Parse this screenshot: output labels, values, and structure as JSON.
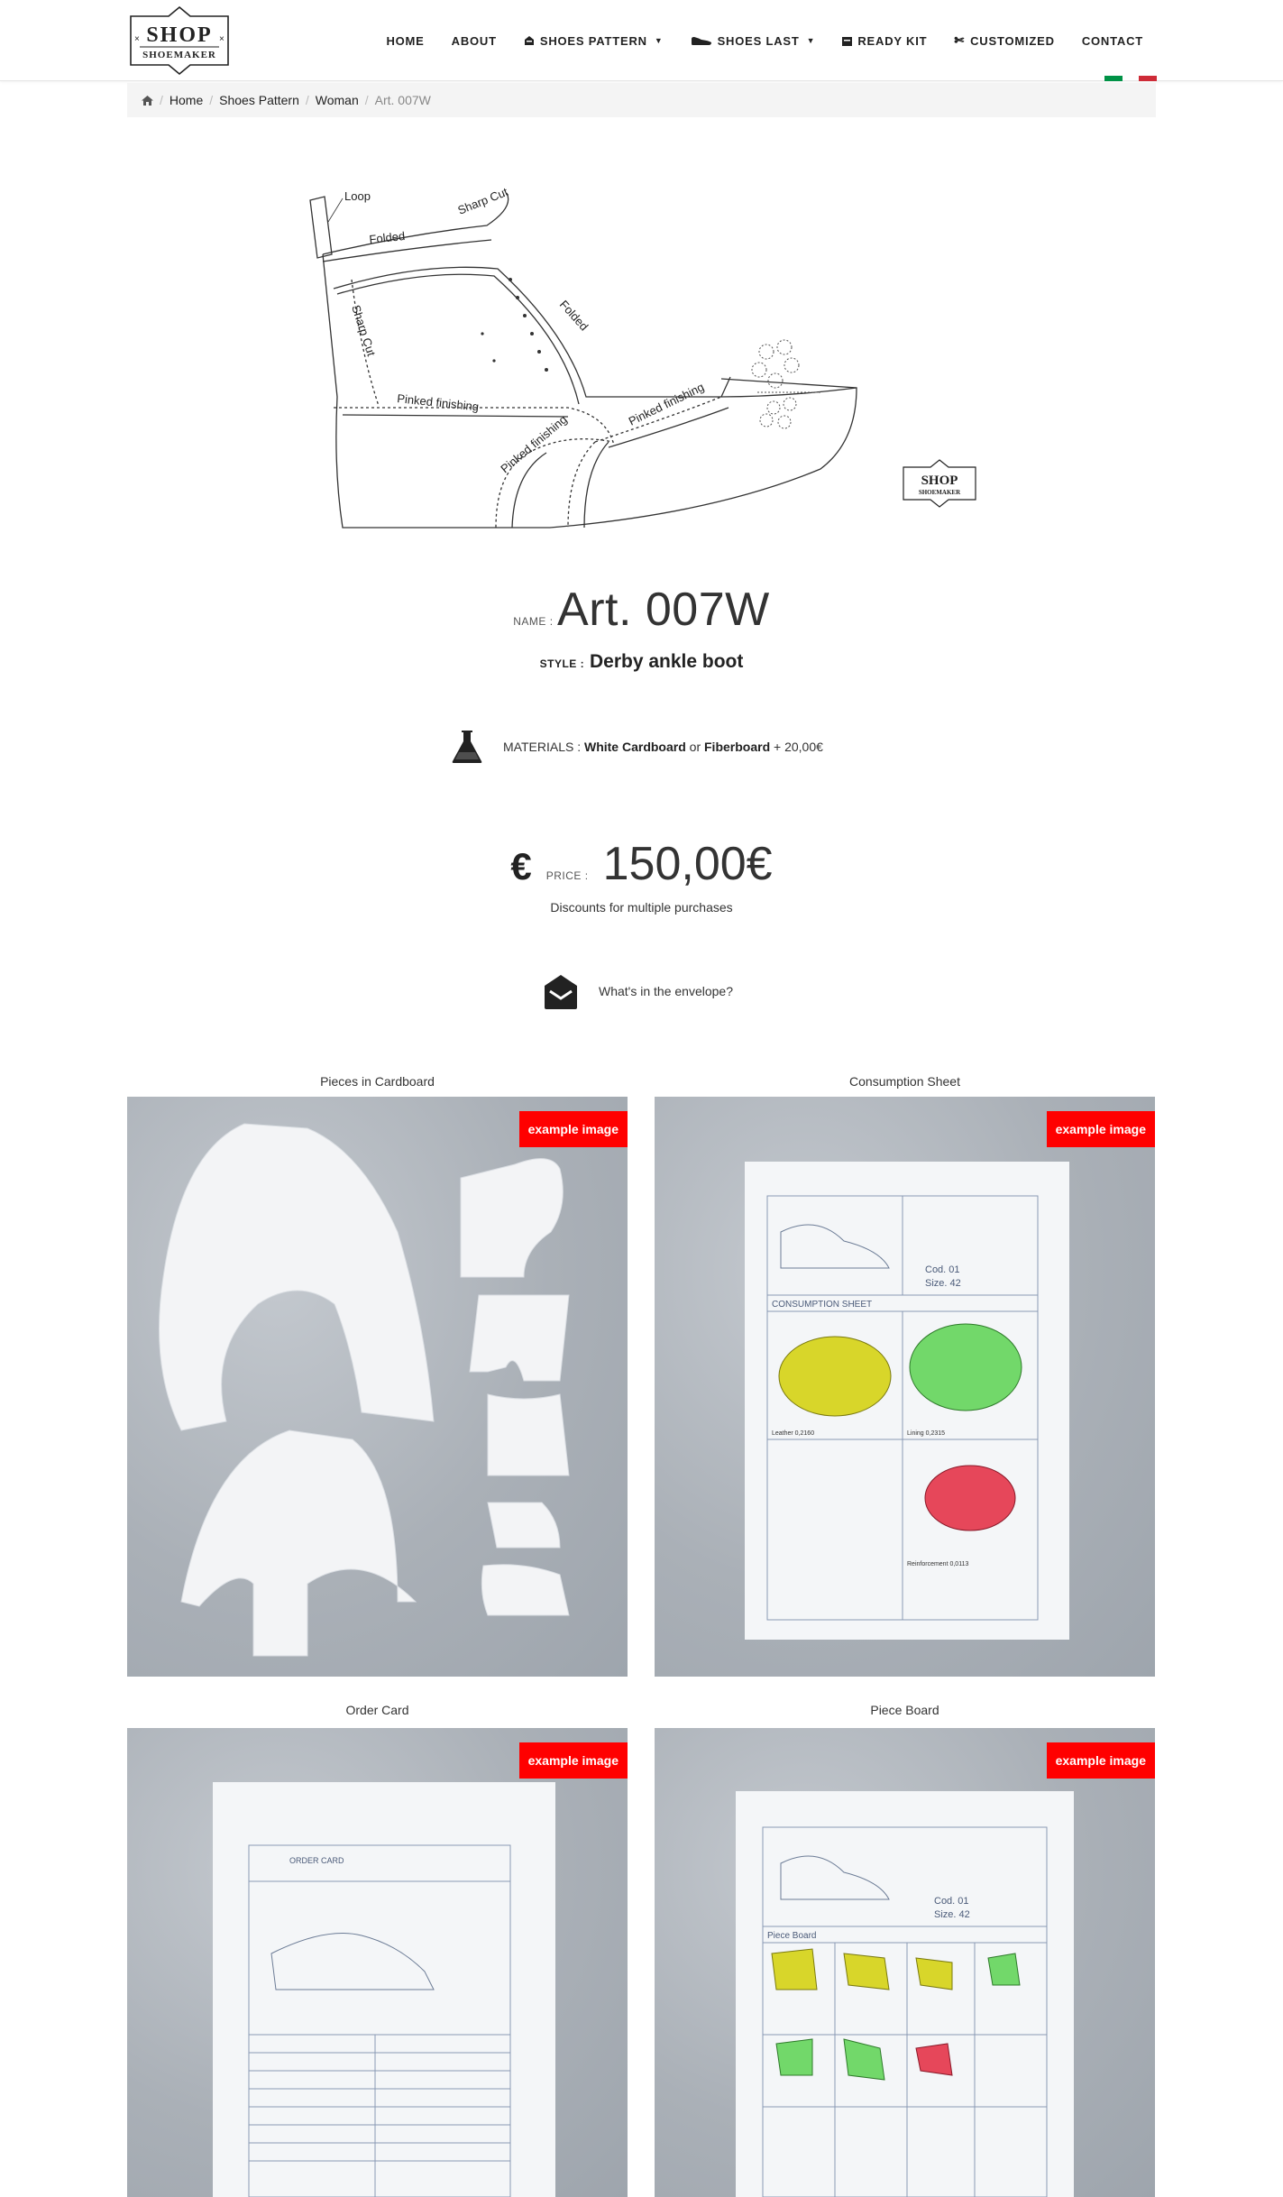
{
  "brand": {
    "logo_line1": "SHOP",
    "logo_line2": "SHOEMAKER"
  },
  "nav": [
    {
      "label": "HOME",
      "icon": ""
    },
    {
      "label": "ABOUT",
      "icon": ""
    },
    {
      "label": "SHOES PATTERN",
      "icon": "pattern-icon",
      "caret": true
    },
    {
      "label": "SHOES LAST",
      "icon": "shoe-last-icon",
      "caret": true
    },
    {
      "label": "READY KIT",
      "icon": "kit-icon"
    },
    {
      "label": "CUSTOMIZED",
      "icon": "scissors-icon"
    },
    {
      "label": "CONTACT",
      "icon": ""
    }
  ],
  "languages": [
    {
      "name": "Italian",
      "colors": [
        "#009246",
        "#ffffff",
        "#ce2b37"
      ]
    },
    {
      "name": "English",
      "colors": [
        "#ce2b37",
        "#ffffff",
        "#ce2b37"
      ]
    }
  ],
  "breadcrumb": {
    "home_icon": "home-icon",
    "items": [
      "Home",
      "Shoes Pattern",
      "Woman"
    ],
    "current": "Art. 007W"
  },
  "drawing_labels": {
    "loop": "Loop",
    "folded1": "Folded",
    "sharp_cut1": "Sharp Cut",
    "folded2": "Folded",
    "sharp_cut2": "Sharp Cut",
    "pinked1": "Pinked finishing",
    "pinked2": "Pinked finishing",
    "pinked3": "Pinked finishing"
  },
  "product": {
    "name_label": "NAME :",
    "name": "Art. 007W",
    "style_label": "STYLE :",
    "style": "Derby ankle boot",
    "materials_label": "MATERIALS :",
    "material1": "White Cardboard",
    "or_word": "or",
    "material2": "Fiberboard",
    "material2_extra": "+ 20,00€",
    "currency_symbol": "€",
    "price_label": "PRICE :",
    "price": "150,00€",
    "discount_note": "Discounts for multiple purchases",
    "envelope_link": "What's in the envelope?"
  },
  "gallery": {
    "badge": "example image",
    "items": [
      {
        "caption": "Pieces in Cardboard"
      },
      {
        "caption": "Consumption Sheet"
      },
      {
        "caption": "Order Card"
      },
      {
        "caption": "Piece Board"
      }
    ]
  },
  "sheet_texts": {
    "cod_label": "Cod.",
    "cod_value": "01",
    "size_label": "Size.",
    "size_value": "42",
    "consumption_title": "CONSUMPTION SHEET",
    "leather": "Leather",
    "leather_val": "0,2160",
    "lining": "Lining",
    "lining_val": "0,2315",
    "reinforcement": "Reinforcement",
    "reinforcement_val": "0,0113",
    "order_card_title": "ORDER CARD",
    "piece_board_title": "Piece Board"
  },
  "colors": {
    "badge": "#ff0000",
    "photo_bg": "#aeb4bc",
    "breadcrumb_bg": "#f4f4f4"
  }
}
